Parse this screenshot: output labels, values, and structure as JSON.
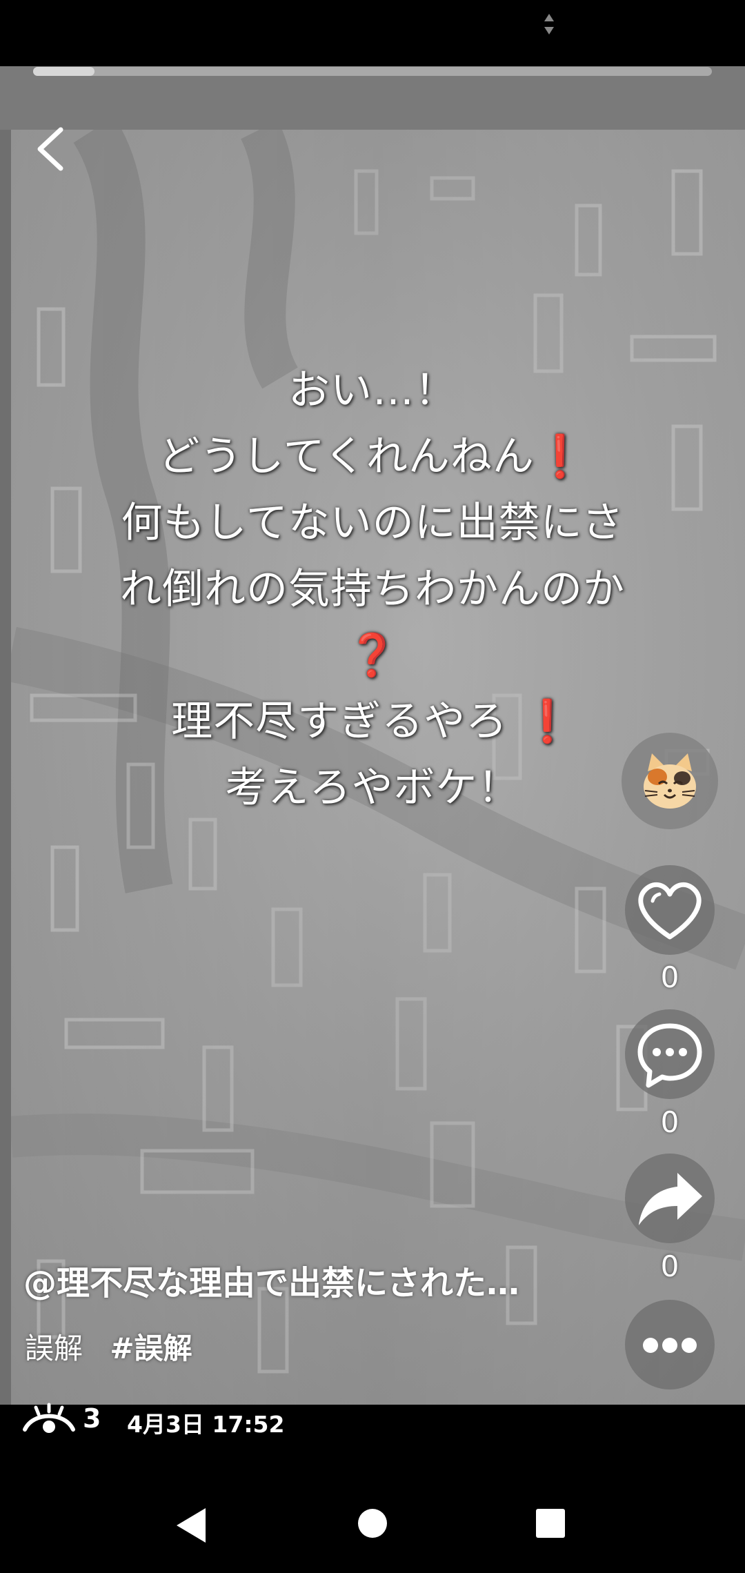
{
  "colors": {
    "background": "#000000",
    "overlay_text": "#ffffff",
    "emoji_red": "#e8231a",
    "rail_button_bg": "#6e6e6e",
    "progress_fill": "#d7d7d7"
  },
  "playback": {
    "progress": 0.09
  },
  "overlay": {
    "lines": [
      "おい…！",
      "どうしてくれんねん",
      "何もしてないのに出禁にさ",
      "れ倒れの気持ちわかんのか",
      "❓",
      "理不尽すぎるやろ",
      "考えろやボケ！"
    ],
    "exclamation": "❗"
  },
  "rail": {
    "avatar_icon": "cat-face-icon",
    "like_count": "0",
    "comment_count": "0",
    "share_count": "0",
    "icons": [
      "heart-icon",
      "comment-icon",
      "share-icon",
      "more-icon"
    ]
  },
  "post": {
    "author": "@理不尽な理由で出禁にされた…",
    "caption": "誤解",
    "hashtag": "#誤解",
    "views": "3",
    "date": "4月3日 17:52"
  },
  "nav": {
    "icons": [
      "back-triangle-icon",
      "home-circle-icon",
      "recents-square-icon"
    ]
  }
}
